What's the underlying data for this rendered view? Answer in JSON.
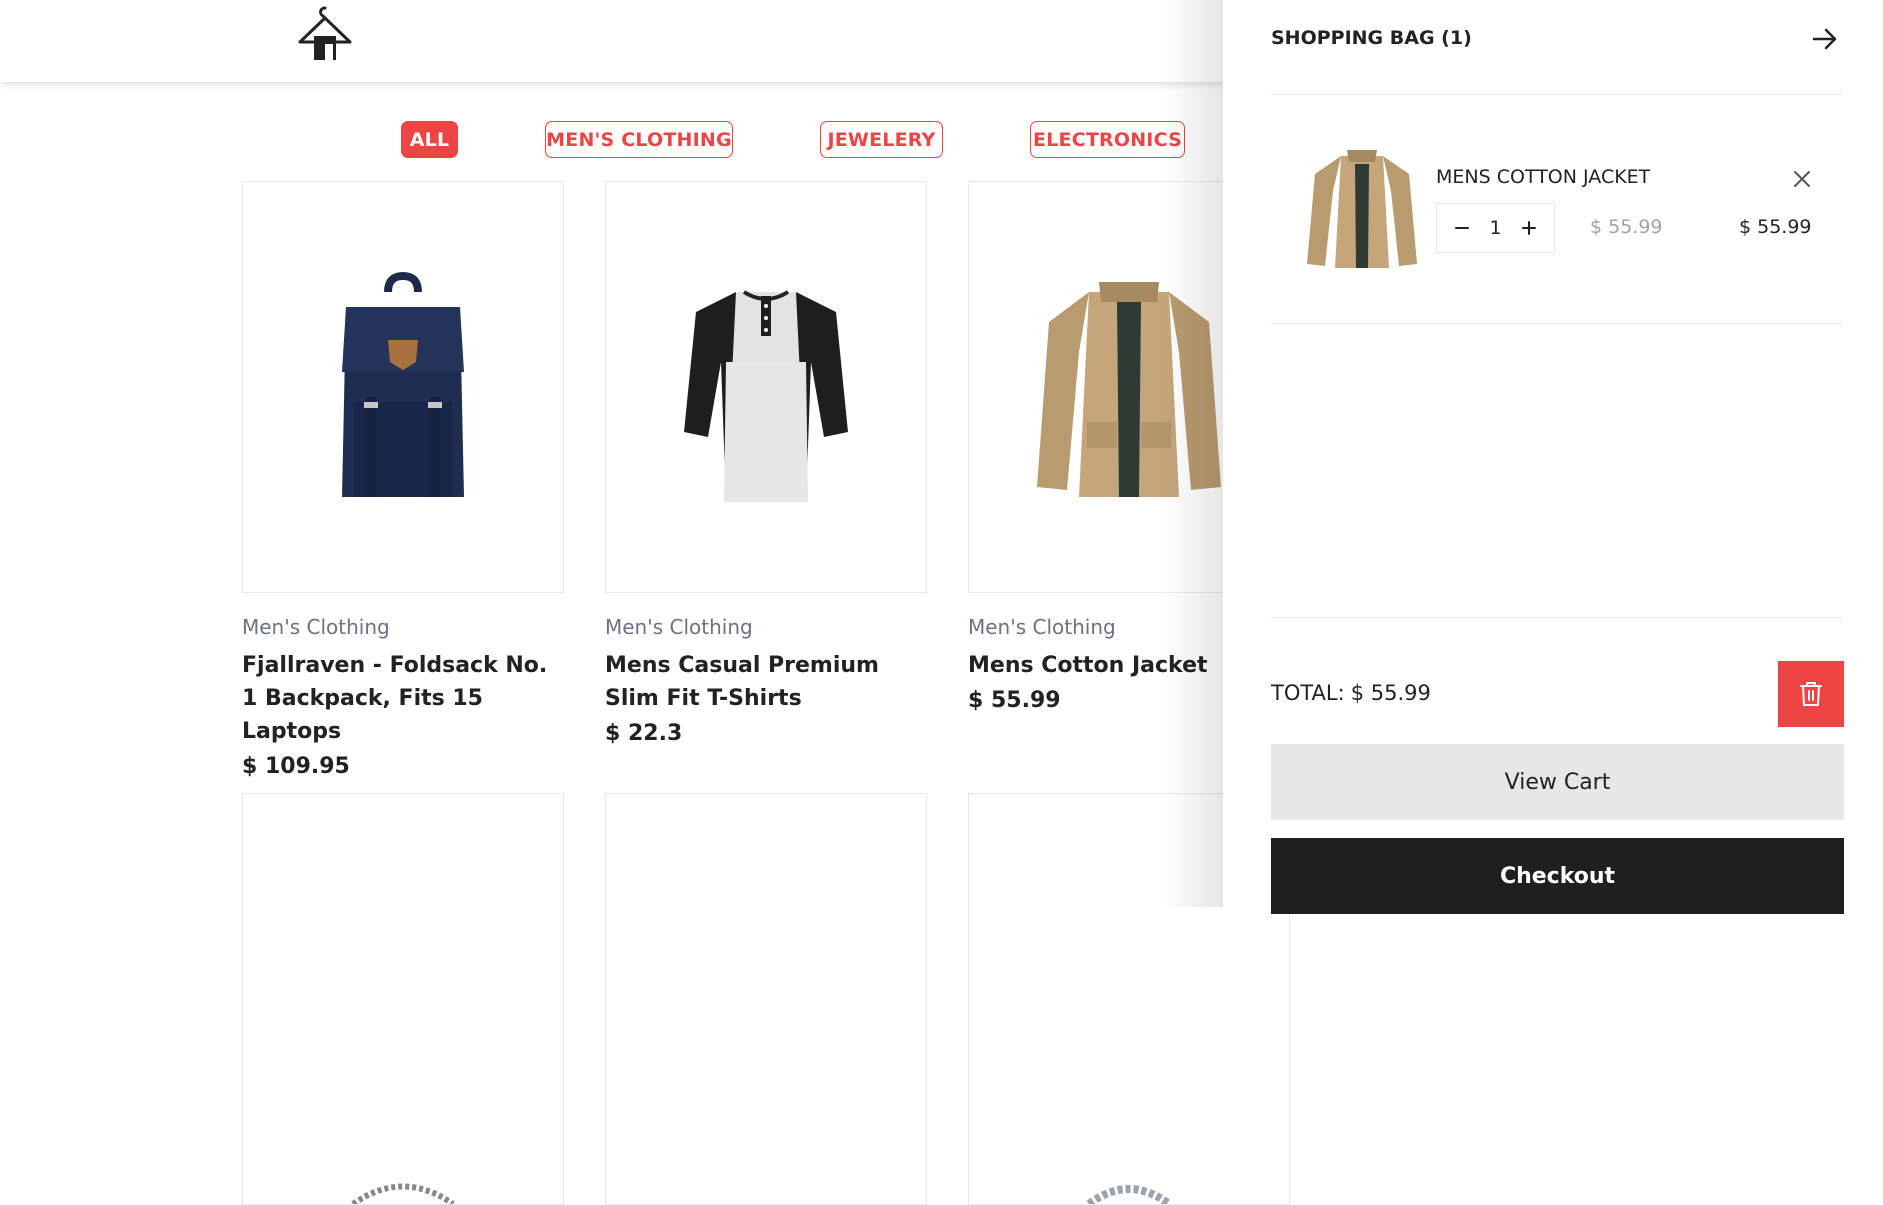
{
  "filters": [
    {
      "label": "ALL",
      "active": true
    },
    {
      "label": "MEN'S CLOTHING",
      "active": false
    },
    {
      "label": "JEWELERY",
      "active": false
    },
    {
      "label": "ELECTRONICS",
      "active": false
    }
  ],
  "products": [
    {
      "category": "Men's Clothing",
      "title": "Fjallraven - Foldsack No. 1 Backpack, Fits 15 Laptops",
      "price": "$ 109.95",
      "image": "backpack-image"
    },
    {
      "category": "Men's Clothing",
      "title": "Mens Casual Premium Slim Fit T-Shirts",
      "price": "$ 22.3",
      "image": "tshirt-image"
    },
    {
      "category": "Men's Clothing",
      "title": "Mens Cotton Jacket",
      "price": "$ 55.99",
      "image": "jacket-image"
    }
  ],
  "cart": {
    "title": "SHOPPING BAG (1)",
    "close_icon": "arrow-right-icon",
    "items": [
      {
        "name": "MENS COTTON JACKET",
        "quantity": "1",
        "unit_price": "$ 55.99",
        "line_total": "$ 55.99",
        "image": "jacket-image"
      }
    ],
    "total_label": "TOTAL:",
    "total_value": "$ 55.99",
    "clear_icon": "trash-icon",
    "view_cart_label": "View Cart",
    "checkout_label": "Checkout"
  },
  "colors": {
    "accent": "#ef4444",
    "dark": "#1f1f1f",
    "muted": "#6b7280"
  }
}
